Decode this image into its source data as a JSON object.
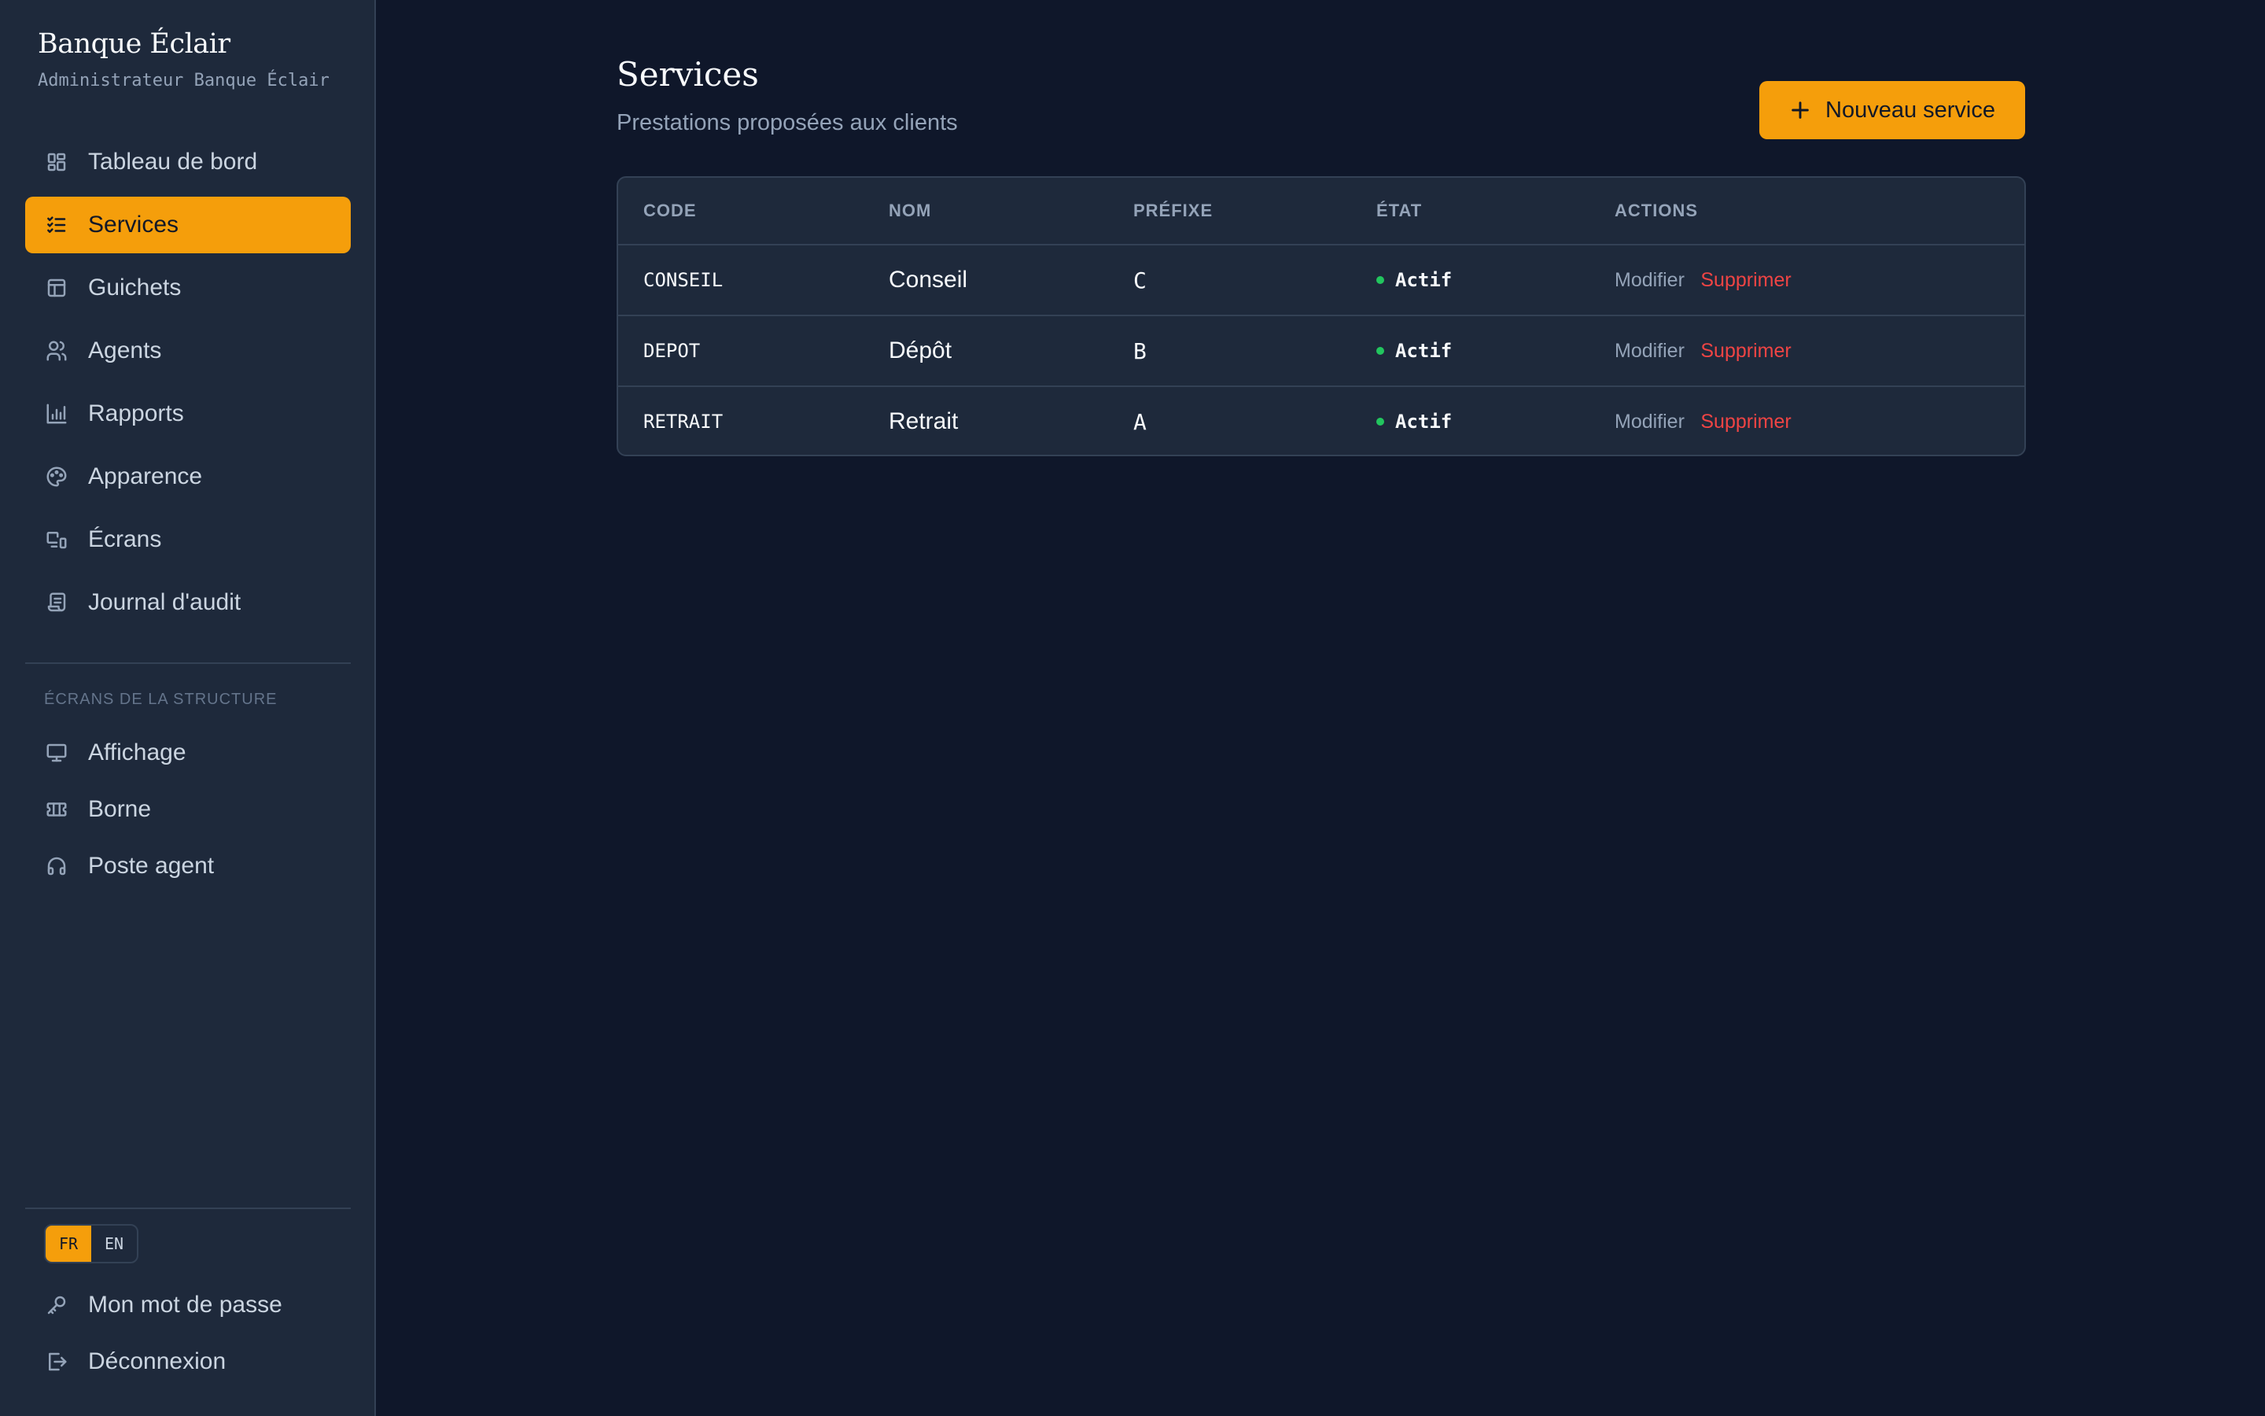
{
  "brand": {
    "title": "Banque Éclair",
    "subtitle": "Administrateur Banque Éclair"
  },
  "nav": {
    "items": [
      {
        "label": "Tableau de bord",
        "icon": "dashboard-icon"
      },
      {
        "label": "Services",
        "icon": "list-check-icon",
        "active": true
      },
      {
        "label": "Guichets",
        "icon": "layout-icon"
      },
      {
        "label": "Agents",
        "icon": "users-icon"
      },
      {
        "label": "Rapports",
        "icon": "bar-chart-icon"
      },
      {
        "label": "Apparence",
        "icon": "palette-icon"
      },
      {
        "label": "Écrans",
        "icon": "devices-icon"
      },
      {
        "label": "Journal d'audit",
        "icon": "scroll-icon"
      }
    ],
    "section_label": "ÉCRANS DE LA STRUCTURE",
    "screens": [
      {
        "label": "Affichage",
        "icon": "monitor-icon"
      },
      {
        "label": "Borne",
        "icon": "ticket-icon"
      },
      {
        "label": "Poste agent",
        "icon": "headphones-icon"
      }
    ],
    "lang": {
      "fr": "FR",
      "en": "EN",
      "selected": "FR"
    },
    "bottom": [
      {
        "label": "Mon mot de passe",
        "icon": "key-icon"
      },
      {
        "label": "Déconnexion",
        "icon": "logout-icon"
      }
    ]
  },
  "main": {
    "title": "Services",
    "subtitle": "Prestations proposées aux clients",
    "new_button": "Nouveau service",
    "table": {
      "headers": [
        "CODE",
        "NOM",
        "PRÉFIXE",
        "ÉTAT",
        "ACTIONS"
      ],
      "rows": [
        {
          "code": "CONSEIL",
          "name": "Conseil",
          "prefix": "C",
          "state": "Actif",
          "edit": "Modifier",
          "delete": "Supprimer"
        },
        {
          "code": "DEPOT",
          "name": "Dépôt",
          "prefix": "B",
          "state": "Actif",
          "edit": "Modifier",
          "delete": "Supprimer"
        },
        {
          "code": "RETRAIT",
          "name": "Retrait",
          "prefix": "A",
          "state": "Actif",
          "edit": "Modifier",
          "delete": "Supprimer"
        }
      ]
    }
  },
  "colors": {
    "accent": "#f59e0b",
    "background": "#0f172a",
    "sidebar": "#1e293b",
    "status_active": "#22c55e",
    "danger": "#ef4444"
  }
}
